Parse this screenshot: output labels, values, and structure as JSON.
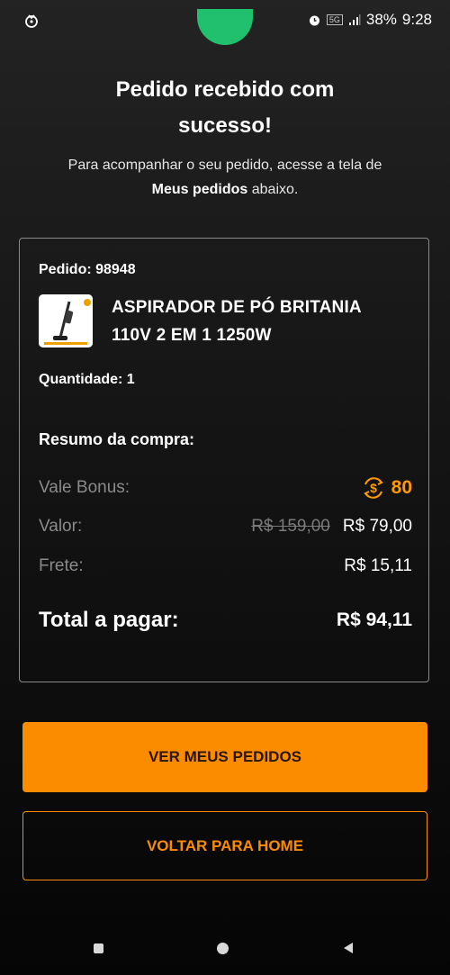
{
  "status_bar": {
    "network": "5G",
    "battery": "38%",
    "time": "9:28"
  },
  "header": {
    "title_line1": "Pedido recebido com",
    "title_line2": "sucesso!",
    "subtitle_before": "Para acompanhar o seu pedido, acesse a tela de ",
    "subtitle_bold": "Meus pedidos",
    "subtitle_after": " abaixo."
  },
  "order": {
    "id_label": "Pedido: 98948",
    "product_name_line1": "ASPIRADOR DE PÓ BRITANIA",
    "product_name_line2": "110V 2 EM 1  1250W",
    "quantity_label": "Quantidade: 1"
  },
  "summary": {
    "heading": "Resumo da compra:",
    "bonus_label": "Vale Bonus:",
    "bonus_value": "80",
    "value_label": "Valor:",
    "value_original": "R$ 159,00",
    "value_current": "R$ 79,00",
    "shipping_label": "Frete:",
    "shipping_value": "R$ 15,11",
    "total_label": "Total a pagar:",
    "total_value": "R$ 94,11"
  },
  "buttons": {
    "orders": "VER MEUS PEDIDOS",
    "home": "VOLTAR PARA HOME"
  },
  "colors": {
    "accent": "#fb8c00",
    "success": "#21c06e"
  }
}
